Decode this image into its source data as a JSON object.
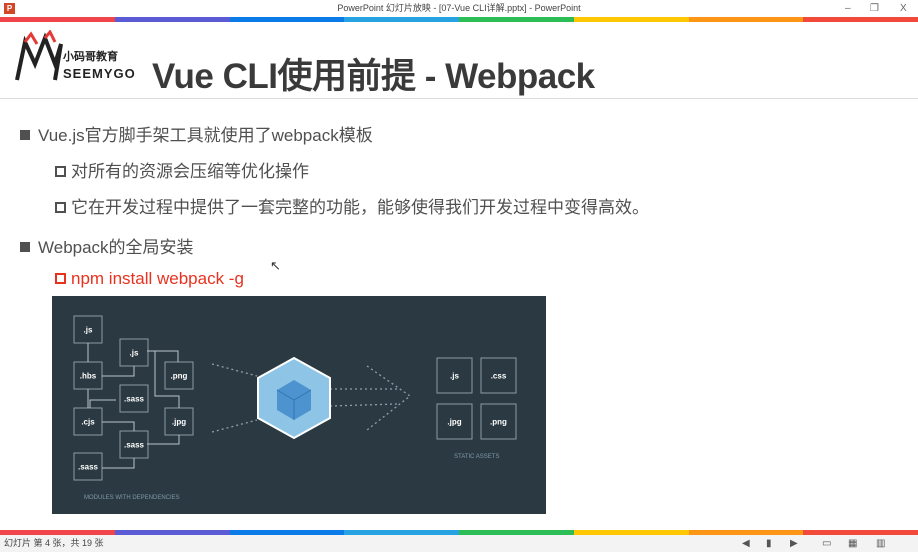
{
  "window": {
    "title": "PowerPoint 幻灯片放映 - [07-Vue CLI详解.pptx] - PowerPoint",
    "app_icon": "P",
    "minimize": "–",
    "restore": "❐",
    "close": "X"
  },
  "rainbow_colors": [
    "#f0464b",
    "#5b5bd6",
    "#0b7be8",
    "#27a3e3",
    "#2dbd57",
    "#ffc700",
    "#ff9515",
    "#f24a3a"
  ],
  "slide": {
    "logo": {
      "text_cn": "小码哥教育",
      "text_en": "SEEMYGO"
    },
    "title": "Vue CLI使用前提 - Webpack",
    "bullets": [
      {
        "text": "Vue.js官方脚手架工具就使用了webpack模板",
        "sub": [
          "对所有的资源会压缩等优化操作",
          "它在开发过程中提供了一套完整的功能，能够使得我们开发过程中变得高效。"
        ]
      },
      {
        "text": "Webpack的全局安装",
        "sub": [
          "npm install webpack -g"
        ]
      }
    ],
    "command_color": "#e8321f",
    "diagram": {
      "modules": [
        ".js",
        ".js",
        ".hbs",
        ".png",
        ".sass",
        ".cjs",
        ".jpg",
        ".sass",
        ".sass"
      ],
      "assets": [
        ".js",
        ".css",
        ".jpg",
        ".png"
      ],
      "modules_label": "MODULES WITH DEPENDENCIES",
      "assets_label": "STATIC ASSETS",
      "background": "#2b3a42"
    }
  },
  "status": {
    "slide_info": "幻灯片 第 4 张，共 19 张"
  }
}
